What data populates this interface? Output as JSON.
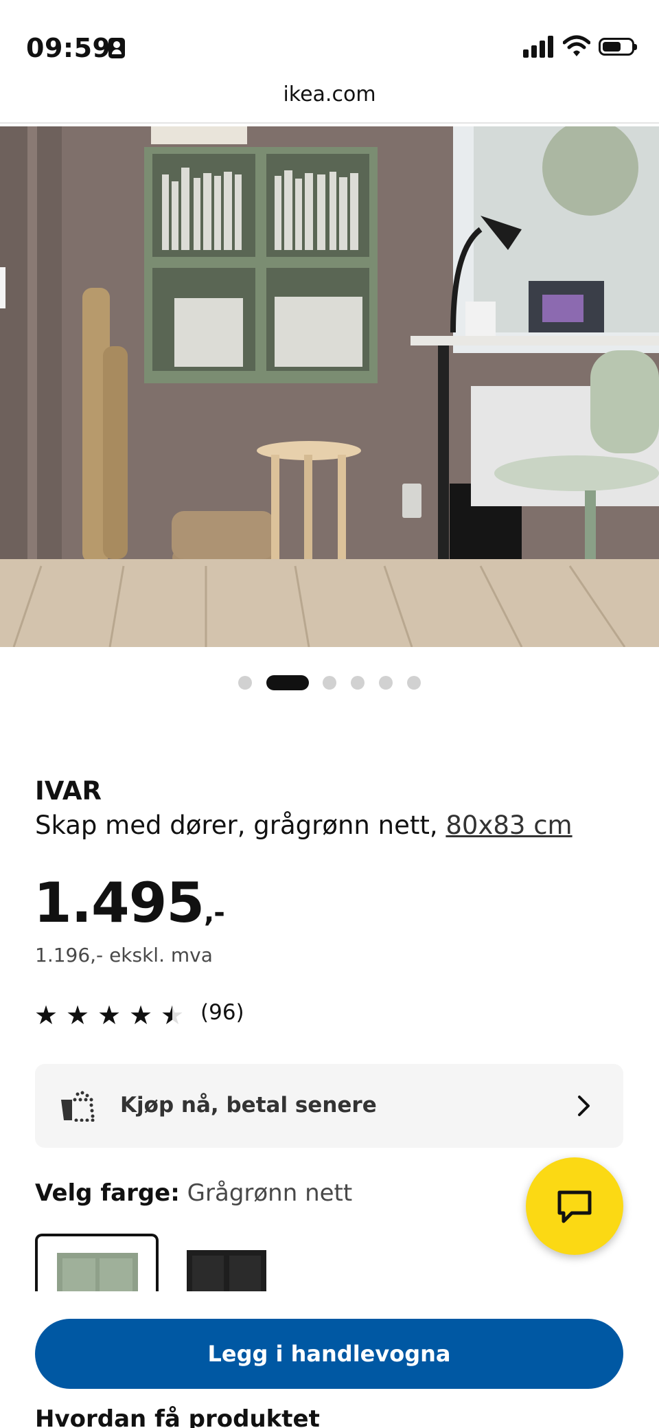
{
  "status_bar": {
    "time": "09:59"
  },
  "browser": {
    "url": "ikea.com"
  },
  "carousel": {
    "total": 6,
    "active_index": 1
  },
  "product": {
    "brand": "IVAR",
    "description": "Skap med dører, grågrønn nett, ",
    "size_link": "80x83 cm",
    "price_main": "1.495",
    "price_suffix": ",-",
    "price_ex_vat": "1.196,- ekskl. mva",
    "rating_value": 4.5,
    "rating_max": 5,
    "review_count": "(96)"
  },
  "bnpl": {
    "label": "Kjøp nå, betal senere",
    "icon": "shopping-bag-dotted-icon"
  },
  "color_select": {
    "label": "Velg farge:",
    "selected": "Grågrønn nett",
    "swatches": [
      {
        "name": "gray-green",
        "color": "#8fa08a"
      },
      {
        "name": "black",
        "color": "#1e1e1e"
      }
    ]
  },
  "chat": {
    "icon": "chat-bubble-icon",
    "color": "#fbd914"
  },
  "cta": {
    "add_to_cart": "Legg i handlevogna",
    "color": "#0058a3"
  },
  "next_section": {
    "heading_peek": "Hvordan få produktet"
  }
}
